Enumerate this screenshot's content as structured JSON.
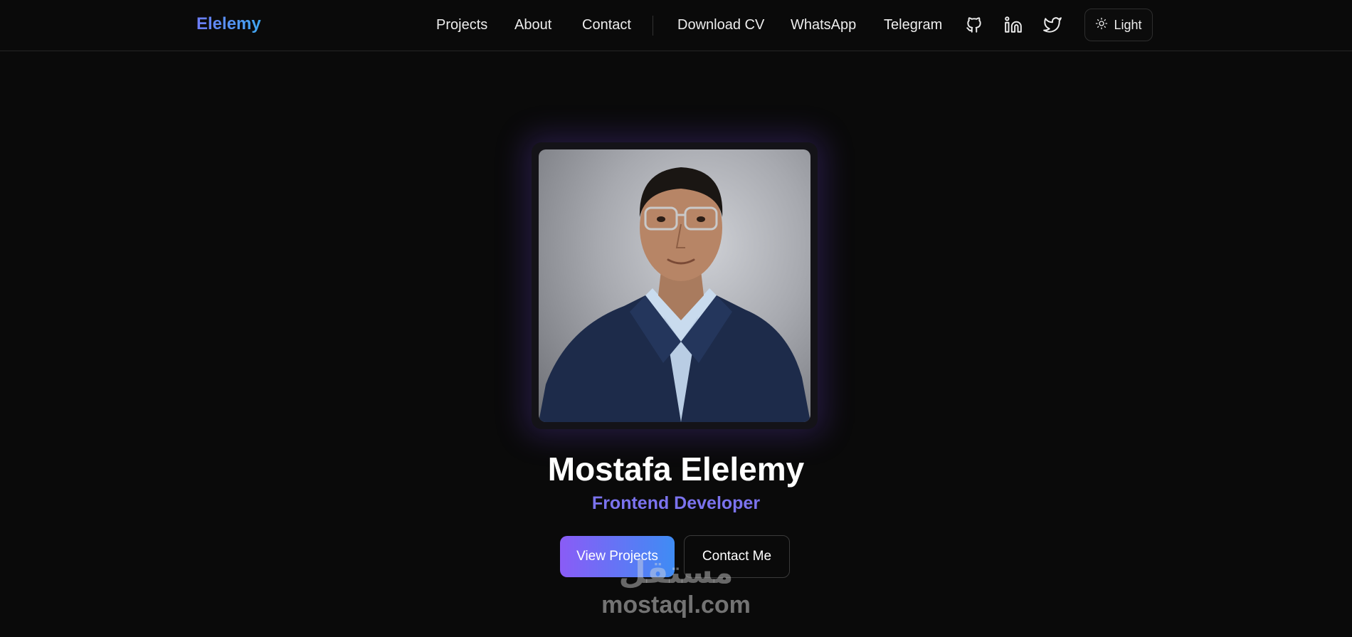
{
  "brand": {
    "logo_text": "Elelemy"
  },
  "nav": {
    "links": [
      "Projects",
      "About",
      "Contact",
      "Download CV",
      "WhatsApp",
      "Telegram"
    ],
    "icons": [
      "github-icon",
      "linkedin-icon",
      "twitter-icon"
    ],
    "theme_toggle": {
      "icon": "sun-icon",
      "label": "Light"
    }
  },
  "hero": {
    "photo_alt": "portrait photo",
    "name": "Mostafa Elelemy",
    "role": "Frontend Developer",
    "primary_button": "View Projects",
    "secondary_button": "Contact Me"
  },
  "watermark": {
    "arabic": "مستقل",
    "latin": "mostaql.com"
  },
  "colors": {
    "background": "#0a0a0a",
    "accent_purple": "#8a5cf6",
    "accent_blue": "#3f8cf4",
    "role_text": "#7b73ee"
  }
}
